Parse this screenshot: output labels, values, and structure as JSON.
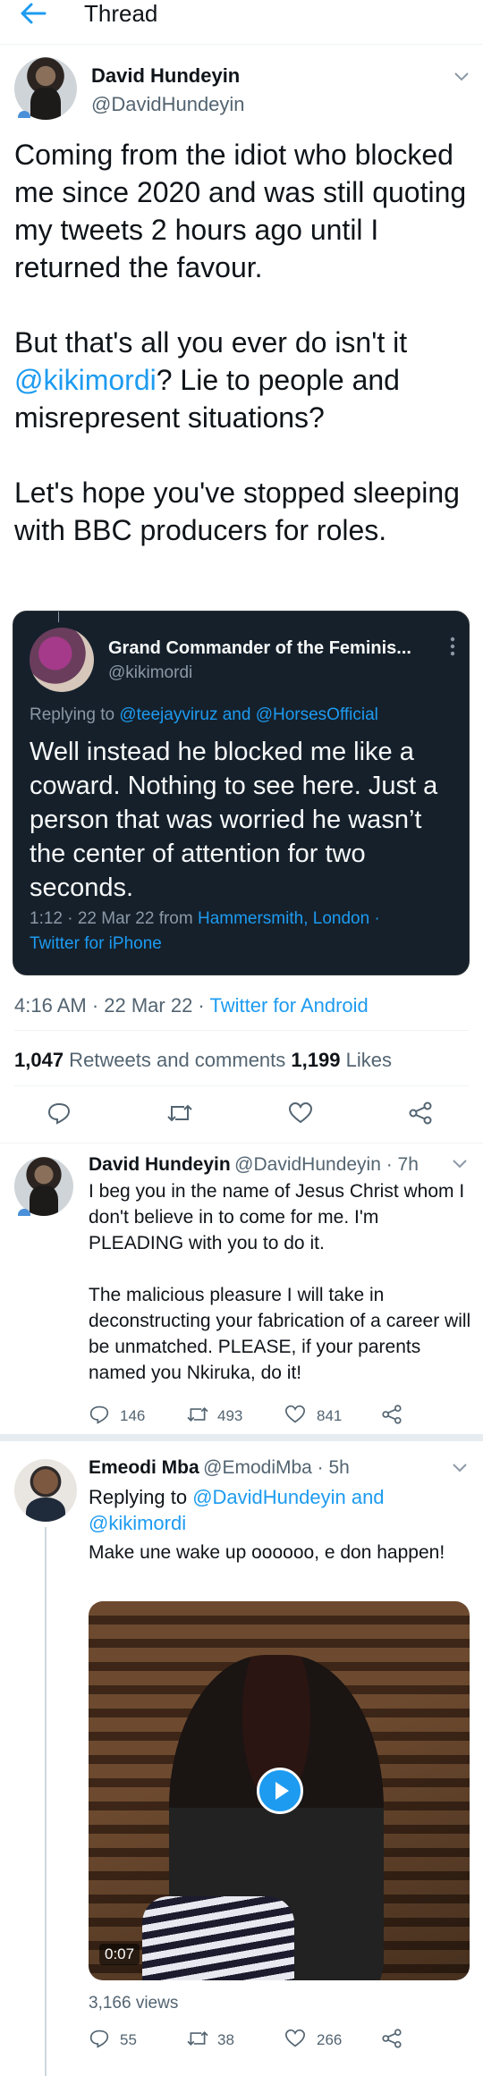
{
  "header": {
    "title": "Thread",
    "back_icon": "arrow-left-icon"
  },
  "main_tweet": {
    "name": "David Hundeyin",
    "handle": "@DavidHundeyin",
    "paragraphs": [
      "Coming from the idiot who blocked me since 2020 and was still quoting my tweets 2 hours ago until I returned the favour.",
      "?",
      "Let's hope you've stopped sleeping with BBC producers for roles."
    ],
    "p2_before": "But that's all you ever do isn't it ",
    "p2_mention": "@kikimordi",
    "p2_after": "? Lie to people and misrepresent situations?",
    "quoted": {
      "name": "Grand Commander of the Feminis...",
      "handle": "@kikimordi",
      "replying_prefix": "Replying to ",
      "replying_to": "@teejayviruz and @HorsesOfficial",
      "text": "Well instead he blocked me like a coward. Nothing to see here. Just a person that was worried he wasn’t the center of attention for two seconds.",
      "meta_time": "1:12 · 22 Mar 22 from ",
      "meta_location": "Hammersmith, London ·",
      "meta_source": "Twitter for iPhone"
    },
    "time": "4:16 AM · 22 Mar 22 · ",
    "source": "Twitter for Android",
    "retweets_count": "1,047",
    "retweets_label": " Retweets and comments ",
    "likes_count": "1,199",
    "likes_label": " Likes"
  },
  "reply1": {
    "name": "David Hundeyin",
    "handle_time": "@DavidHundeyin · 7h",
    "text_a": "I beg you in the name of Jesus Christ whom I don't believe in to come for me. I'm PLEADING with you to do it.",
    "text_b": "The malicious pleasure I will take in deconstructing your fabrication of a career will be unmatched. PLEASE, if your parents named you Nkiruka, do it!",
    "replies": "146",
    "retweets": "493",
    "likes": "841"
  },
  "reply2": {
    "name": "Emeodi Mba",
    "handle_time": "@EmodiMba · 5h",
    "replying_prefix": "Replying to ",
    "replying_to": "@DavidHundeyin and @kikimordi",
    "text": "Make une wake up oooooo, e don happen!",
    "video_duration": "0:07",
    "views": "3,166 views",
    "replies": "55",
    "retweets": "38",
    "likes": "266"
  },
  "colors": {
    "accent": "#1d9bf0",
    "text": "#0f1419",
    "muted": "#536471",
    "quote_bg": "#15202b"
  }
}
